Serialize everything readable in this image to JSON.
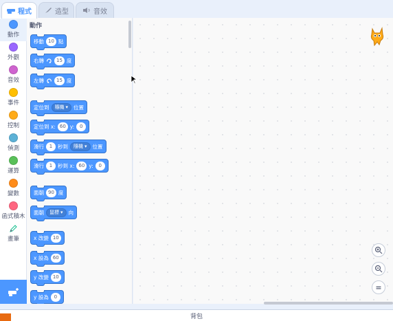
{
  "tabs": [
    {
      "label": "程式",
      "icon": "code-icon",
      "active": true
    },
    {
      "label": "造型",
      "icon": "brush-icon",
      "active": false
    },
    {
      "label": "音效",
      "icon": "speaker-icon",
      "active": false
    }
  ],
  "categories": [
    {
      "label": "動作",
      "color": "#4c97ff",
      "selected": true
    },
    {
      "label": "外觀",
      "color": "#9966ff"
    },
    {
      "label": "音效",
      "color": "#cf63cf"
    },
    {
      "label": "事件",
      "color": "#ffbf00"
    },
    {
      "label": "控制",
      "color": "#ffab19"
    },
    {
      "label": "偵測",
      "color": "#5cb1d6"
    },
    {
      "label": "運算",
      "color": "#59c059"
    },
    {
      "label": "變數",
      "color": "#ff8c1a"
    },
    {
      "label": "函式積木",
      "color": "#ff6680"
    },
    {
      "label": "畫筆",
      "icon": "pen-icon"
    }
  ],
  "palette": {
    "title": "動作",
    "blocks": {
      "move": {
        "label": "移動",
        "value": "10",
        "suffix": "點"
      },
      "turn_right": {
        "label": "右轉",
        "value": "15",
        "suffix": "度"
      },
      "turn_left": {
        "label": "左轉",
        "value": "15",
        "suffix": "度"
      },
      "goto": {
        "label": "定位到",
        "dropdown": "隨機",
        "suffix": "位置"
      },
      "goto_xy": {
        "label": "定位到 x:",
        "x": "60",
        "ylabel": "y:",
        "y": "0"
      },
      "glide_to": {
        "label": "滑行",
        "secs": "1",
        "mid": "秒到",
        "dropdown": "隨機",
        "suffix": "位置"
      },
      "glide_xy": {
        "label": "滑行",
        "secs": "1",
        "mid": "秒到 x:",
        "x": "60",
        "ylabel": "y:",
        "y": "0"
      },
      "point_dir": {
        "label": "面朝",
        "value": "90",
        "suffix": "度"
      },
      "point_towards": {
        "label": "面朝",
        "dropdown": "鼠標",
        "suffix": "向"
      },
      "change_x": {
        "label": "x 改變",
        "value": "10"
      },
      "set_x": {
        "label": "x 設為",
        "value": "60"
      },
      "change_y": {
        "label": "y 改變",
        "value": "10"
      },
      "set_y": {
        "label": "y 設為",
        "value": "0"
      }
    }
  },
  "zoom": {
    "in": "+",
    "out": "−",
    "reset": "="
  },
  "backpack": {
    "label": "背包"
  },
  "colors": {
    "motion": "#4c97ff",
    "accent": "#4c97ff",
    "backpack_accent": "#e86a10"
  }
}
